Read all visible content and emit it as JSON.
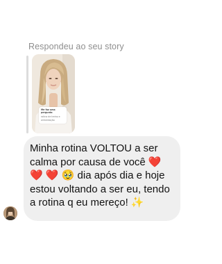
{
  "reply_context": {
    "label": "Respondeu ao seu story",
    "story": {
      "sticker_question": "Me faz uma pergunta",
      "sticker_answer": "rotina de treino e alimentação"
    }
  },
  "message": {
    "text": "Minha rotina VOLTOU a ser calma por causa de você ❤️ ❤️ ❤️ 🥹 dia após dia e hoje estou voltando a ser eu, tendo a rotina q eu mereço! ✨"
  },
  "colors": {
    "bubble_bg": "#efefef",
    "secondary_text": "#8e8e8e",
    "reply_bar": "#dcdcdc"
  },
  "icons": {
    "avatar": "profile-photo"
  }
}
